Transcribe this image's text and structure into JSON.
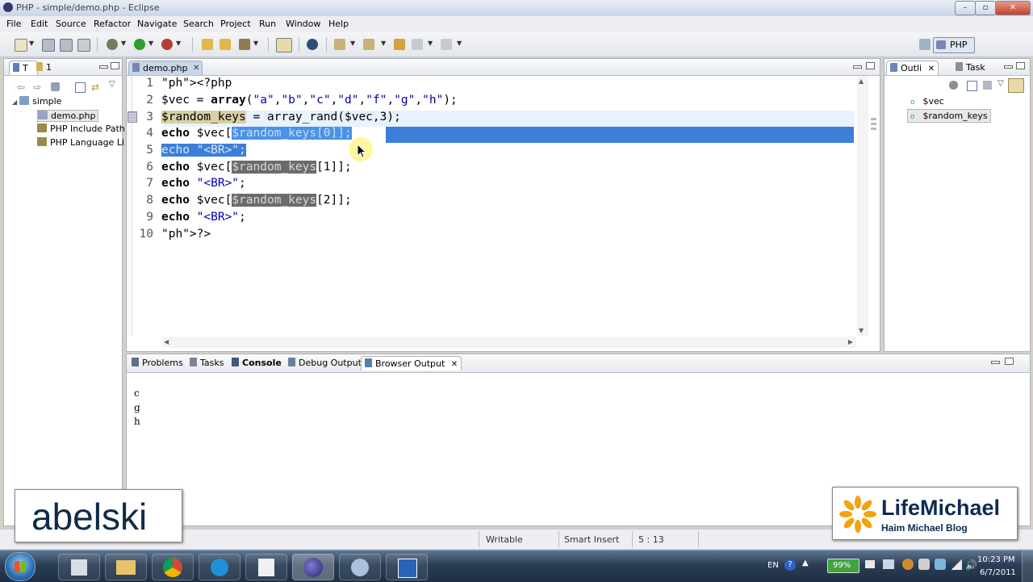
{
  "window": {
    "title": "PHP - simple/demo.php - Eclipse",
    "min": "–",
    "max": "▫",
    "close": "✕"
  },
  "menu": [
    "File",
    "Edit",
    "Source",
    "Refactor",
    "Navigate",
    "Search",
    "Project",
    "Run",
    "Window",
    "Help"
  ],
  "perspective": {
    "label": "PHP"
  },
  "explorer": {
    "tabs": [
      "T",
      "1"
    ],
    "items": [
      {
        "label": "simple",
        "icon": "folder-icon"
      },
      {
        "label": "demo.php",
        "icon": "php-file-icon"
      },
      {
        "label": "PHP Include Path",
        "icon": "library-icon"
      },
      {
        "label": "PHP Language Li",
        "icon": "library-icon"
      }
    ]
  },
  "editor": {
    "tab": "demo.php",
    "lines": [
      {
        "n": "1",
        "text": "<?php"
      },
      {
        "n": "2",
        "text": "$vec = array(\"a\",\"b\",\"c\",\"d\",\"f\",\"g\",\"h\");"
      },
      {
        "n": "3",
        "text": "$random_keys = array_rand($vec,3);"
      },
      {
        "n": "4",
        "text": "echo $vec[$random_keys[0]];"
      },
      {
        "n": "5",
        "text": "echo \"<BR>\";"
      },
      {
        "n": "6",
        "text": "echo $vec[$random_keys[1]];"
      },
      {
        "n": "7",
        "text": "echo \"<BR>\";"
      },
      {
        "n": "8",
        "text": "echo $vec[$random_keys[2]];"
      },
      {
        "n": "9",
        "text": "echo \"<BR>\";"
      },
      {
        "n": "10",
        "text": "?>"
      }
    ]
  },
  "outline": {
    "tabs": [
      "Outli",
      "Task"
    ],
    "items": [
      "$vec",
      "$random_keys"
    ]
  },
  "bottom": {
    "tabs": [
      "Problems",
      "Tasks",
      "Console",
      "Debug Output",
      "Browser Output"
    ],
    "output": [
      "c",
      "g",
      "h"
    ]
  },
  "status": {
    "writable": "Writable",
    "insert": "Smart Insert",
    "position": "5 : 13"
  },
  "taskbar": {
    "lang": "EN",
    "battery": "99%",
    "time": "10:23 PM",
    "date": "6/7/2011"
  },
  "watermarks": {
    "left": "abelski",
    "right_title": "LifeMichael",
    "right_sub": "Haim Michael Blog"
  },
  "colors": {
    "selection": "#3b7fd9",
    "occurrence": "#6b6b6b",
    "keyword": "#000000",
    "phpTag": "#b40000",
    "string": "#0000aa"
  }
}
